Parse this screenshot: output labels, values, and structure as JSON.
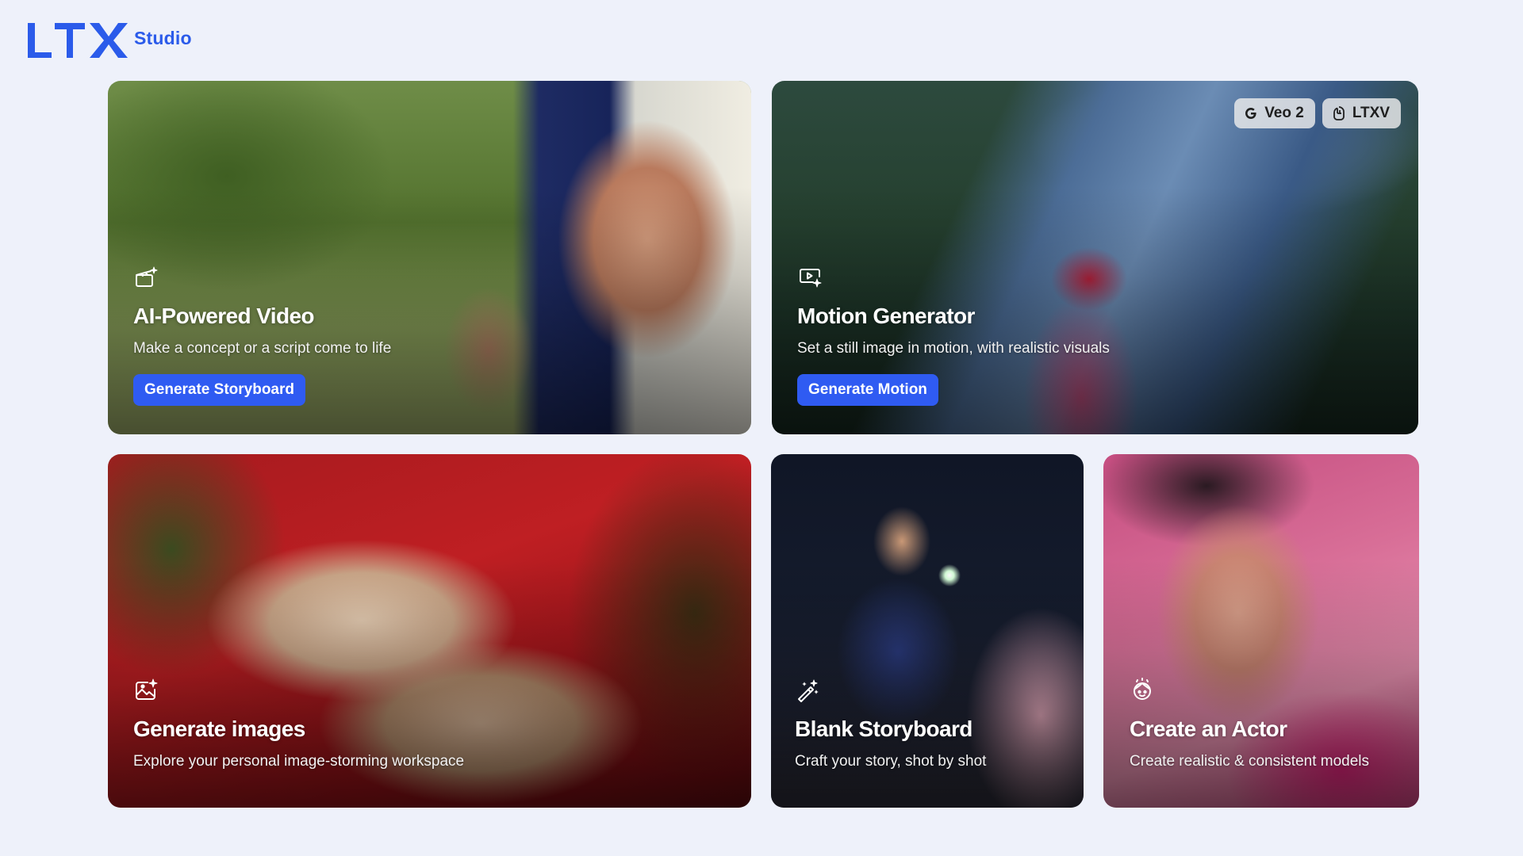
{
  "brand": {
    "logo_text": "LTX",
    "product": "Studio",
    "accent": "#2b5bea"
  },
  "cards": {
    "video": {
      "icon": "clapperboard-sparkle-icon",
      "title": "AI-Powered Video",
      "description": "Make a concept or a script come to life",
      "button": "Generate Storyboard"
    },
    "motion": {
      "icon": "video-sparkle-icon",
      "title": "Motion Generator",
      "description": "Set a still image in motion, with realistic visuals",
      "button": "Generate Motion",
      "badges": [
        {
          "label": "Veo 2",
          "icon": "google-icon"
        },
        {
          "label": "LTXV",
          "icon": "ltxv-icon"
        }
      ]
    },
    "images": {
      "icon": "image-sparkle-icon",
      "title": "Generate images",
      "description": "Explore your personal image-storming workspace"
    },
    "blank": {
      "icon": "magic-wand-icon",
      "title": "Blank Storyboard",
      "description": "Craft your story, shot by shot"
    },
    "actor": {
      "icon": "actor-face-icon",
      "title": "Create an Actor",
      "description": "Create realistic & consistent models"
    }
  },
  "colors": {
    "page_bg": "#eef1fa",
    "button_bg": "#2f5bf2"
  }
}
